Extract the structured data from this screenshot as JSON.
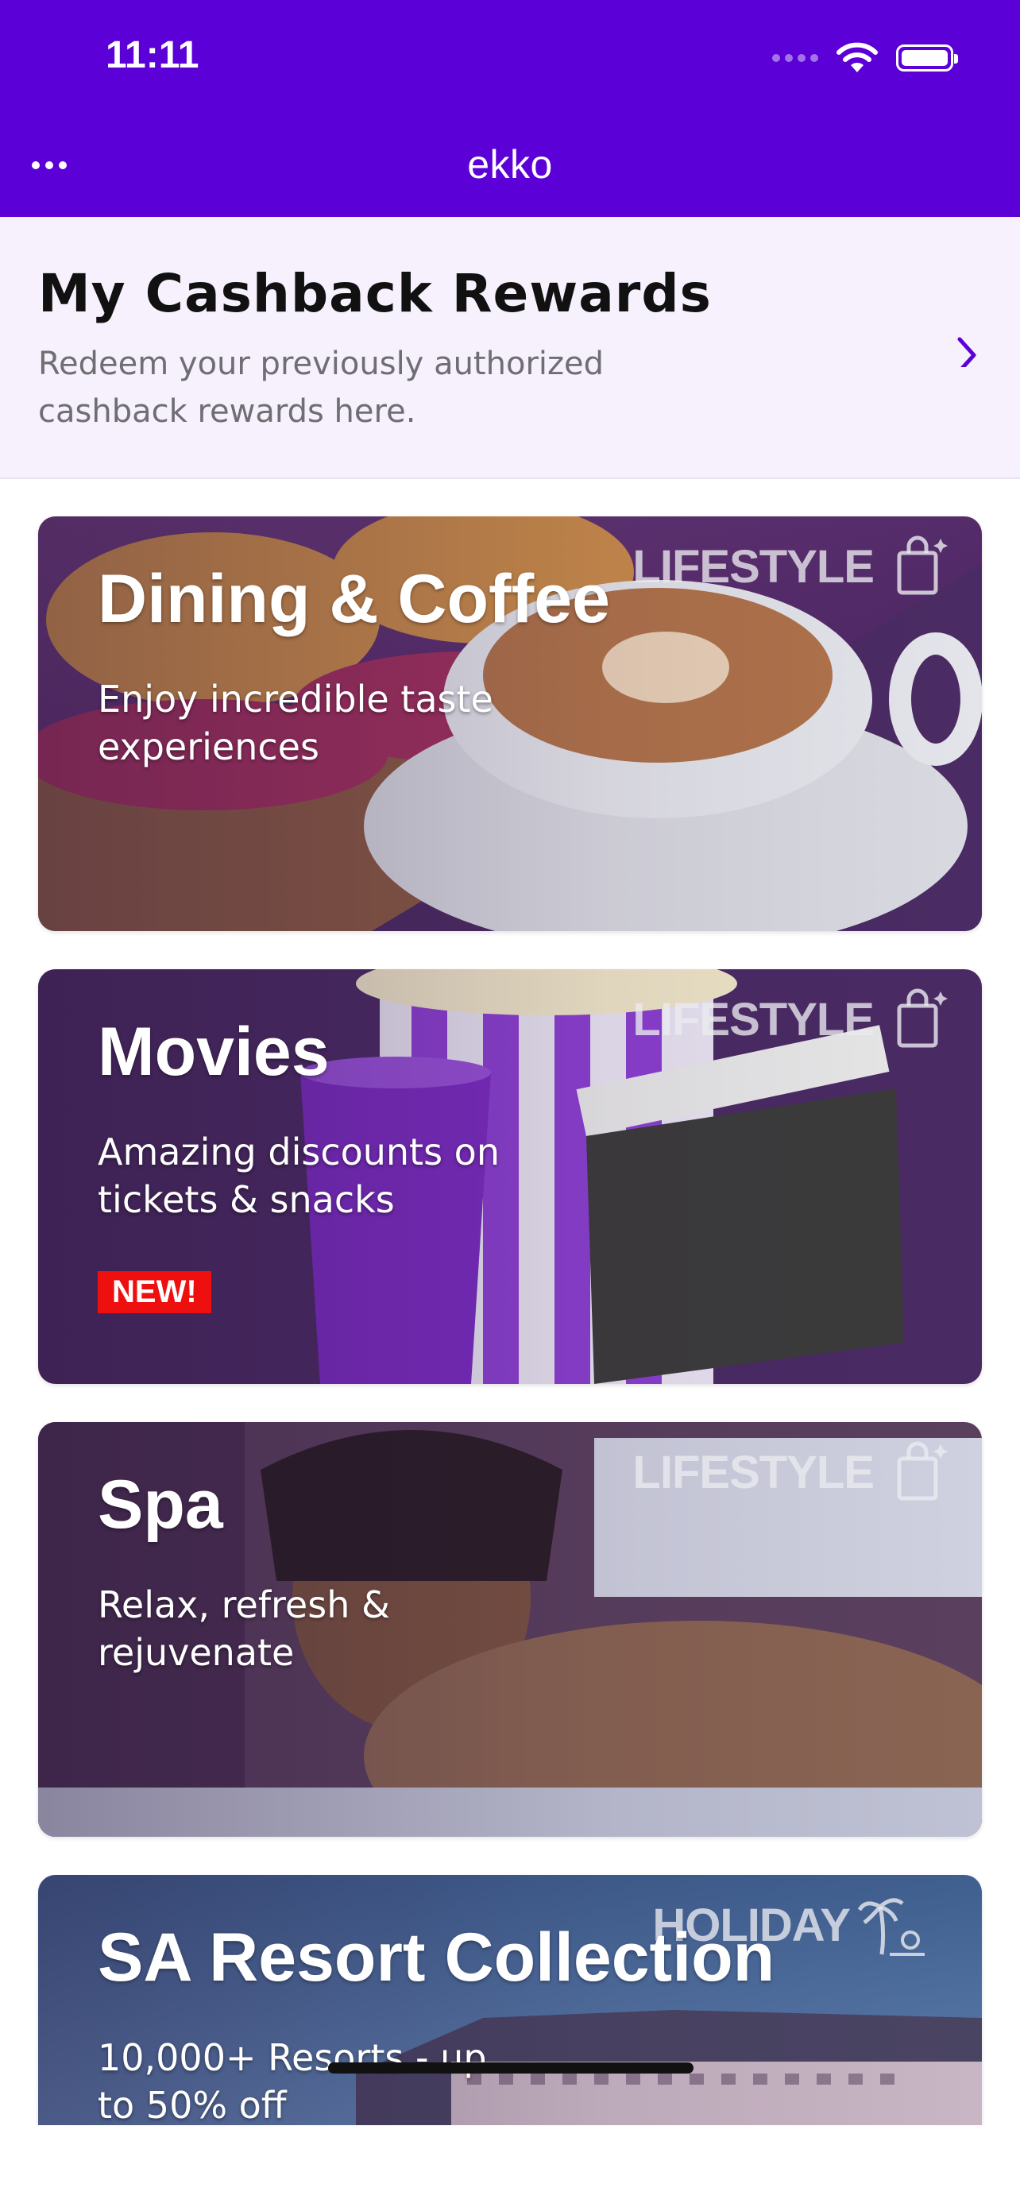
{
  "status_bar": {
    "time": "11:11"
  },
  "nav": {
    "title": "ekko"
  },
  "cashback": {
    "title": "My Cashback Rewards",
    "subtitle": "Redeem your previously authorized cashback rewards here."
  },
  "cards": [
    {
      "title": "Dining & Coffee",
      "subtitle": "Enjoy incredible taste experiences",
      "tag": "LIFESTYLE"
    },
    {
      "title": "Movies",
      "subtitle": "Amazing discounts on tickets & snacks",
      "tag": "LIFESTYLE",
      "badge": "NEW!"
    },
    {
      "title": "Spa",
      "subtitle": "Relax, refresh & rejuvenate",
      "tag": "LIFESTYLE"
    },
    {
      "title": "SA Resort Collection",
      "subtitle": "10,000+ Resorts - up to 50% off",
      "tag": "HOLIDAY"
    }
  ],
  "colors": {
    "brand": "#5b00d6",
    "badge": "#ee0f0f"
  }
}
